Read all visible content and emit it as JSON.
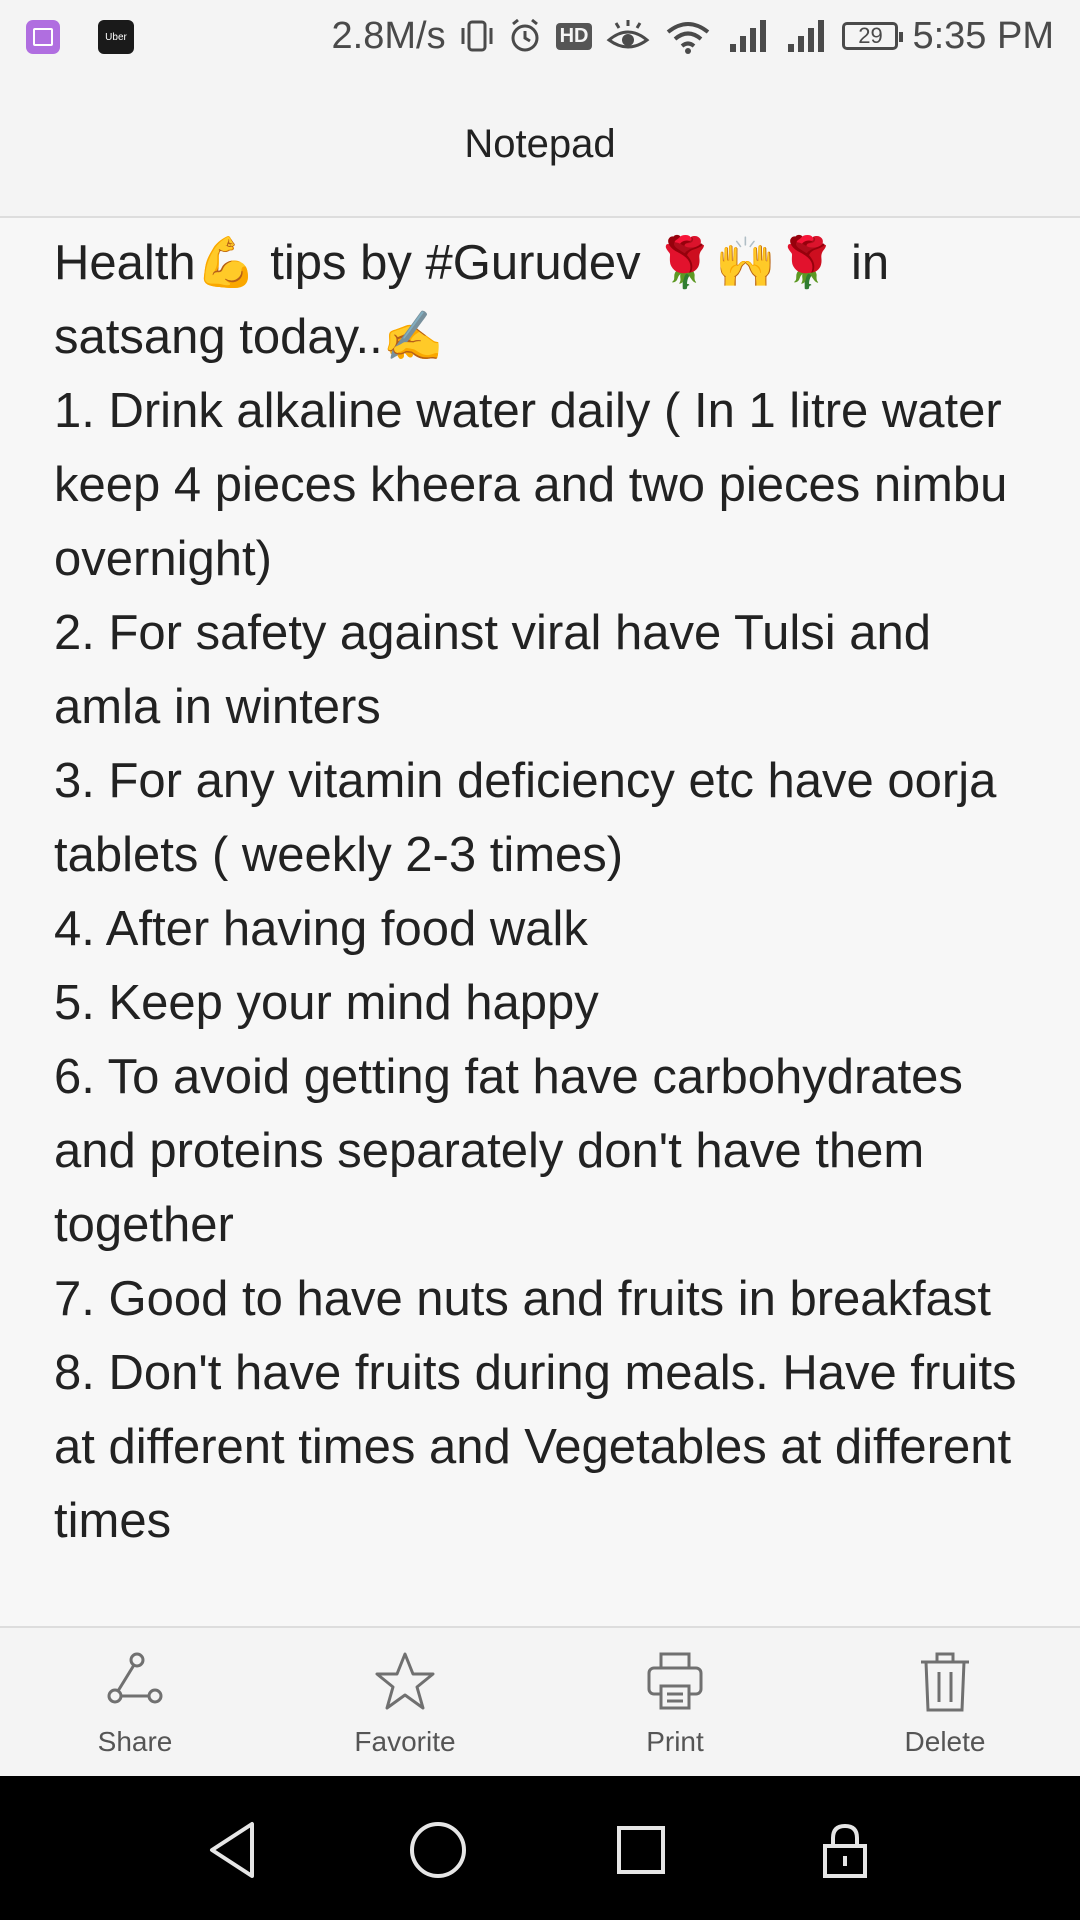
{
  "status_bar": {
    "notifications": [
      {
        "icon": "gallery-app-icon"
      },
      {
        "icon": "uber-app-icon",
        "label": "Uber"
      }
    ],
    "net_speed": "2.8M/s",
    "hd_label": "HD",
    "battery": "29",
    "time": "5:35 PM"
  },
  "header": {
    "title": "Notepad"
  },
  "note": {
    "text": "Health💪 tips by #Gurudev 🌹🙌🌹 in satsang today..✍\n1. Drink alkaline water daily ( In 1 litre water keep 4 pieces kheera and two pieces nimbu overnight)\n2. For safety against viral have Tulsi and amla in winters\n3. For any vitamin deficiency etc have oorja tablets ( weekly 2-3 times)\n4. After having food walk\n5. Keep your mind happy\n6. To avoid getting fat have carbohydrates and proteins separately don't have them together\n7. Good to have nuts and fruits in breakfast\n8. Don't have fruits during meals. Have fruits at different times and Vegetables at different times"
  },
  "toolbar": {
    "share": "Share",
    "favorite": "Favorite",
    "print": "Print",
    "delete": "Delete"
  },
  "nav": {
    "icons": [
      "back-icon",
      "home-icon",
      "recents-icon",
      "lock-icon"
    ]
  },
  "colors": {
    "background": "#f7f7f7",
    "bar": "#f4f4f4",
    "text": "#222222",
    "icon": "#666666",
    "navbar": "#000000"
  }
}
